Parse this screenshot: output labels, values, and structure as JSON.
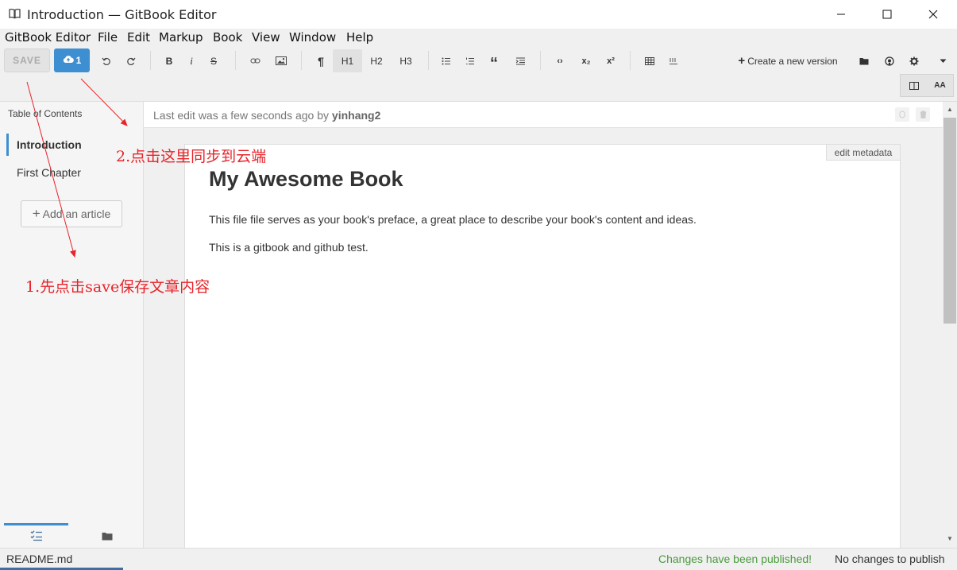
{
  "window": {
    "title": "Introduction — GitBook Editor",
    "icon": "book-icon",
    "controls": [
      "minimize-icon",
      "maximize-icon",
      "close-icon"
    ]
  },
  "menu": [
    "GitBook Editor",
    "File",
    "Edit",
    "Markup",
    "Book",
    "View",
    "Window",
    "Help"
  ],
  "toolbar": {
    "save_label": "SAVE",
    "sync_count": "1",
    "bold": "B",
    "italic": "i",
    "strike": "S",
    "paragraph": "¶",
    "h1": "H1",
    "h2": "H2",
    "h3": "H3",
    "quote": "“",
    "code": "‹›",
    "subscript": "x₂",
    "superscript": "x²",
    "create_version": "Create a new version",
    "layout_font": "AA"
  },
  "sidebar": {
    "title": "Table of Contents",
    "items": [
      {
        "label": "Introduction",
        "active": true
      },
      {
        "label": "First Chapter",
        "active": false
      }
    ],
    "add_article": "Add an article"
  },
  "editor": {
    "last_edit_prefix": "Last edit was a few seconds ago by ",
    "last_edit_user": "yinhang2",
    "edit_metadata": "edit metadata",
    "heading": "My Awesome Book",
    "paragraphs": [
      "This file file serves as your book's preface, a great place to describe your book's content and ideas.",
      "This is a gitbook and github test."
    ]
  },
  "status": {
    "file": "README.md",
    "published": "Changes have been published!",
    "no_changes": "No changes to publish"
  },
  "annotations": {
    "step1": "1.先点击save保存文章内容",
    "step2": "2.点击这里同步到云端"
  },
  "colors": {
    "accent": "#3e8fd1",
    "annotation": "#e8232a",
    "published": "#4a9a3c"
  }
}
